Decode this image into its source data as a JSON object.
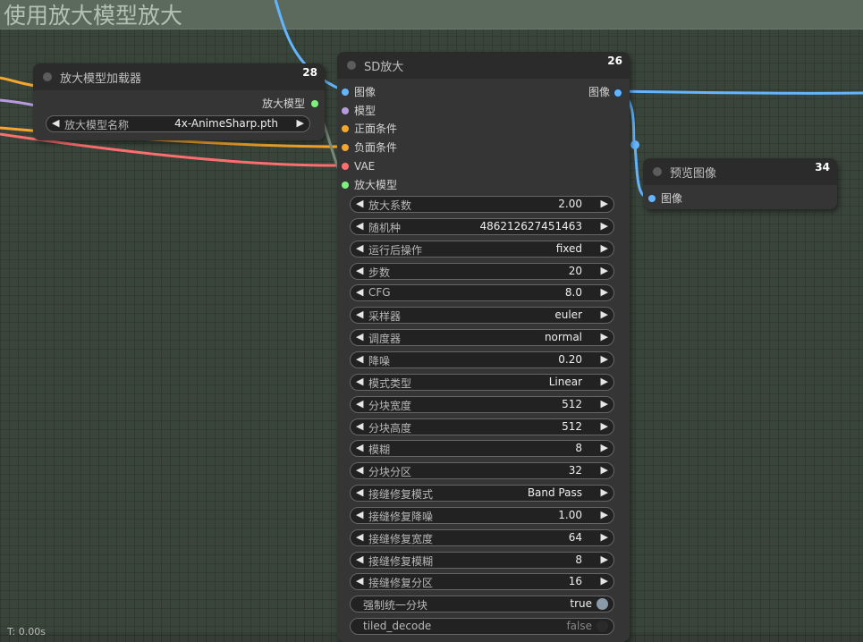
{
  "group": {
    "title": "使用放大模型放大"
  },
  "colors": {
    "image_slot": "#63b5ff",
    "model_slot": "#b79ae0",
    "conditioning_slot": "#f5a62d",
    "vae_slot": "#ff6e6e",
    "upscale_model_slot": "#7df07d"
  },
  "loader_node": {
    "title": "放大模型加载器",
    "id": "28",
    "output_label": "放大模型",
    "combo": {
      "label": "放大模型名称",
      "value": "4x-AnimeSharp.pth"
    }
  },
  "sd_upscale_node": {
    "title": "SD放大",
    "id": "26",
    "output_label": "图像",
    "inputs": [
      {
        "label": "图像",
        "color": "#63b5ff"
      },
      {
        "label": "模型",
        "color": "#b79ae0"
      },
      {
        "label": "正面条件",
        "color": "#f5a62d"
      },
      {
        "label": "负面条件",
        "color": "#f5a62d"
      },
      {
        "label": "VAE",
        "color": "#ff6e6e"
      },
      {
        "label": "放大模型",
        "color": "#7df07d"
      }
    ],
    "widgets": [
      {
        "label": "放大系数",
        "value": "2.00"
      },
      {
        "label": "随机种",
        "value": "486212627451463"
      },
      {
        "label": "运行后操作",
        "value": "fixed"
      },
      {
        "label": "步数",
        "value": "20"
      },
      {
        "label": "CFG",
        "value": "8.0"
      },
      {
        "label": "采样器",
        "value": "euler"
      },
      {
        "label": "调度器",
        "value": "normal"
      },
      {
        "label": "降噪",
        "value": "0.20"
      },
      {
        "label": "模式类型",
        "value": "Linear"
      },
      {
        "label": "分块宽度",
        "value": "512"
      },
      {
        "label": "分块高度",
        "value": "512"
      },
      {
        "label": "模糊",
        "value": "8"
      },
      {
        "label": "分块分区",
        "value": "32"
      },
      {
        "label": "接缝修复模式",
        "value": "Band Pass"
      },
      {
        "label": "接缝修复降噪",
        "value": "1.00"
      },
      {
        "label": "接缝修复宽度",
        "value": "64"
      },
      {
        "label": "接缝修复模糊",
        "value": "8"
      },
      {
        "label": "接缝修复分区",
        "value": "16"
      }
    ],
    "toggles": [
      {
        "label": "强制统一分块",
        "value": "true",
        "on": true
      },
      {
        "label": "tiled_decode",
        "value": "false",
        "on": false
      }
    ]
  },
  "preview_node": {
    "title": "预览图像",
    "id": "34",
    "input_label": "图像"
  },
  "corner_text": "T: 0.00s"
}
